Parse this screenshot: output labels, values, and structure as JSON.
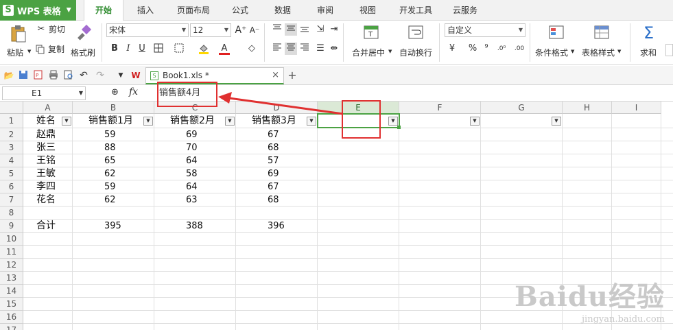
{
  "app": {
    "menu_title": "WPS 表格",
    "menu_logo": "S",
    "accent": "#4ba243"
  },
  "ribbon_tabs": [
    "开始",
    "插入",
    "页面布局",
    "公式",
    "数据",
    "审阅",
    "视图",
    "开发工具",
    "云服务"
  ],
  "ribbon": {
    "paste": "粘贴",
    "cut": "剪切",
    "copy": "复制",
    "format_painter": "格式刷",
    "font_name": "宋体",
    "font_size": "12",
    "bold": "B",
    "italic": "I",
    "underline": "U",
    "merge_center": "合并居中",
    "wrap_text": "自动换行",
    "number_format": "自定义",
    "percent": "%",
    "thousands": "⁹",
    "conditional_format": "条件格式",
    "table_style": "表格样式",
    "sum": "求和",
    "sum_symbol": "Σ"
  },
  "doc_tab": {
    "name": "Book1.xls *",
    "close": "×",
    "new_tab": "+"
  },
  "formula_bar": {
    "name_box": "E1",
    "fx_label": "fx",
    "formula": "销售额4月"
  },
  "sheet": {
    "columns": [
      "A",
      "B",
      "C",
      "D",
      "E",
      "F",
      "G",
      "H",
      "I"
    ],
    "rows": [
      "1",
      "2",
      "3",
      "4",
      "5",
      "6",
      "7",
      "8",
      "9",
      "10",
      "11",
      "12",
      "13",
      "14",
      "15",
      "16",
      "17"
    ],
    "headers": [
      "姓名",
      "销售额1月",
      "销售额2月",
      "销售额3月"
    ],
    "data": [
      [
        "赵鼎",
        "59",
        "69",
        "67"
      ],
      [
        "张三",
        "88",
        "70",
        "68"
      ],
      [
        "王铭",
        "65",
        "64",
        "57"
      ],
      [
        "王敏",
        "62",
        "58",
        "69"
      ],
      [
        "李四",
        "59",
        "64",
        "67"
      ],
      [
        "花名",
        "62",
        "63",
        "68"
      ]
    ],
    "total": [
      "合计",
      "395",
      "388",
      "396"
    ]
  },
  "watermark": {
    "brand": "Baidu经验",
    "url": "jingyan.baidu.com"
  }
}
